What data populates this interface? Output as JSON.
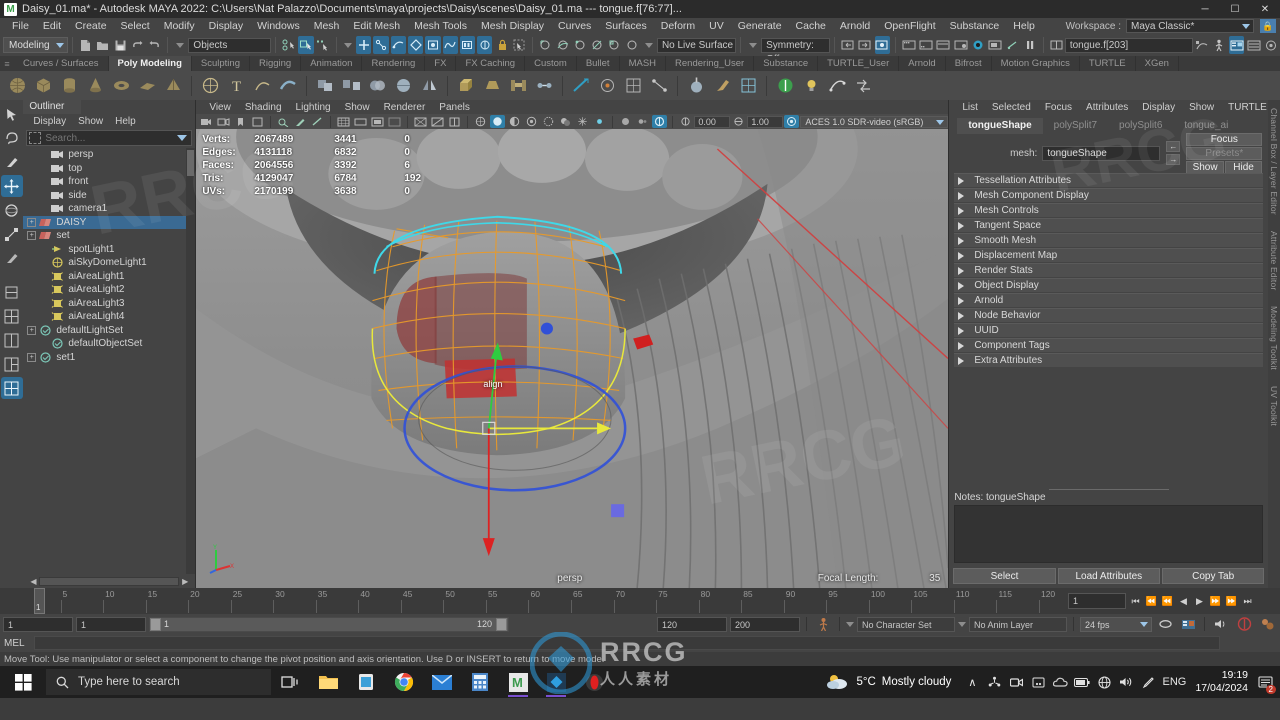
{
  "titlebar": {
    "logo": "M",
    "title": "Daisy_01.ma* - Autodesk MAYA 2022: C:\\Users\\Nat Palazzo\\Documents\\maya\\projects\\Daisy\\scenes\\Daisy_01.ma   ---   tongue.f[76:77]...",
    "minimize": "─",
    "maximize": "☐",
    "close": "✕"
  },
  "menubar": {
    "items": [
      "File",
      "Edit",
      "Create",
      "Select",
      "Modify",
      "Display",
      "Windows",
      "Mesh",
      "Edit Mesh",
      "Mesh Tools",
      "Mesh Display",
      "Curves",
      "Surfaces",
      "Deform",
      "UV",
      "Generate",
      "Cache",
      "Arnold",
      "OpenFlight",
      "Substance",
      "Help"
    ],
    "workspace_label": "Workspace :",
    "workspace_value": "Maya Classic*",
    "lock_icon": "lock-icon"
  },
  "statusbar": {
    "mode": "Modeling",
    "objects_field": "Objects",
    "live_surface": "No Live Surface",
    "symmetry": "Symmetry: Off",
    "selection_field": "tongue.f[203]"
  },
  "shelf_tabs": {
    "items": [
      "Curves / Surfaces",
      "Poly Modeling",
      "Sculpting",
      "Rigging",
      "Animation",
      "Rendering",
      "FX",
      "FX Caching",
      "Custom",
      "Bullet",
      "MASH",
      "Rendering_User",
      "Substance",
      "TURTLE_User",
      "Arnold",
      "Bifrost",
      "Motion Graphics",
      "TURTLE",
      "XGen"
    ],
    "selected": "Poly Modeling"
  },
  "outliner": {
    "tab": "Outliner",
    "menus": [
      "Display",
      "Show",
      "Help"
    ],
    "search_placeholder": "Search...",
    "items": [
      {
        "label": "persp",
        "icon": "camera-icon",
        "expandable": false,
        "selected": false,
        "indent": 1
      },
      {
        "label": "top",
        "icon": "camera-icon",
        "expandable": false,
        "selected": false,
        "indent": 1
      },
      {
        "label": "front",
        "icon": "camera-icon",
        "expandable": false,
        "selected": false,
        "indent": 1
      },
      {
        "label": "side",
        "icon": "camera-icon",
        "expandable": false,
        "selected": false,
        "indent": 1
      },
      {
        "label": "camera1",
        "icon": "camera-icon",
        "expandable": false,
        "selected": false,
        "indent": 1
      },
      {
        "label": "DAISY",
        "icon": "group-icon",
        "expandable": true,
        "selected": true,
        "indent": 0
      },
      {
        "label": "set",
        "icon": "group-icon",
        "expandable": true,
        "selected": false,
        "indent": 0
      },
      {
        "label": "spotLight1",
        "icon": "spotlight-icon",
        "expandable": false,
        "selected": false,
        "indent": 1
      },
      {
        "label": "aiSkyDomeLight1",
        "icon": "skydome-icon",
        "expandable": false,
        "selected": false,
        "indent": 1
      },
      {
        "label": "aiAreaLight1",
        "icon": "arealight-icon",
        "expandable": false,
        "selected": false,
        "indent": 1
      },
      {
        "label": "aiAreaLight2",
        "icon": "arealight-icon",
        "expandable": false,
        "selected": false,
        "indent": 1
      },
      {
        "label": "aiAreaLight3",
        "icon": "arealight-icon",
        "expandable": false,
        "selected": false,
        "indent": 1
      },
      {
        "label": "aiAreaLight4",
        "icon": "arealight-icon",
        "expandable": false,
        "selected": false,
        "indent": 1
      },
      {
        "label": "defaultLightSet",
        "icon": "set-icon",
        "expandable": true,
        "selected": false,
        "indent": 0
      },
      {
        "label": "defaultObjectSet",
        "icon": "set-icon",
        "expandable": false,
        "selected": false,
        "indent": 1
      },
      {
        "label": "set1",
        "icon": "set-icon",
        "expandable": true,
        "selected": false,
        "indent": 0
      }
    ]
  },
  "viewport": {
    "menus": [
      "View",
      "Shading",
      "Lighting",
      "Show",
      "Renderer",
      "Panels"
    ],
    "exposure": "0.00",
    "gamma": "1.00",
    "color_management": "ACES 1.0 SDR-video (sRGB)",
    "camera_label": "persp",
    "focal_length_label": "Focal Length:",
    "focal_length_value": "35",
    "hud": {
      "rows": [
        {
          "label": "Verts:",
          "total": "2067489",
          "selected": "3441",
          "component": "0"
        },
        {
          "label": "Edges:",
          "total": "4131118",
          "selected": "6832",
          "component": "0"
        },
        {
          "label": "Faces:",
          "total": "2064556",
          "selected": "3392",
          "component": "6"
        },
        {
          "label": "Tris:",
          "total": "4129047",
          "selected": "6784",
          "component": "192"
        },
        {
          "label": "UVs:",
          "total": "2170199",
          "selected": "3638",
          "component": "0"
        }
      ]
    },
    "manipulator_label": "align"
  },
  "attribute_editor": {
    "menus": [
      "List",
      "Selected",
      "Focus",
      "Attributes",
      "Display",
      "Show",
      "TURTLE",
      "Help"
    ],
    "tabs": [
      "tongueShape",
      "polySplit7",
      "polySplit6",
      "tongue_ai"
    ],
    "selected_tab": "tongueShape",
    "mesh_label": "mesh:",
    "mesh_value": "tongueShape",
    "focus_button": "Focus",
    "presets_button": "Presets*",
    "show_button": "Show",
    "hide_button": "Hide",
    "sections": [
      "Tessellation Attributes",
      "Mesh Component Display",
      "Mesh Controls",
      "Tangent Space",
      "Smooth Mesh",
      "Displacement Map",
      "Render Stats",
      "Object Display",
      "Arnold",
      "Node Behavior",
      "UUID",
      "Component Tags",
      "Extra Attributes"
    ],
    "notes_label": "Notes:  tongueShape",
    "buttons": [
      "Select",
      "Load Attributes",
      "Copy Tab"
    ],
    "side_tabs": [
      "Channel Box / Layer Editor",
      "Attribute Editor",
      "Modeling Toolkit",
      "UV Toolkit"
    ]
  },
  "timeline": {
    "ticks": [
      5,
      10,
      15,
      20,
      25,
      30,
      35,
      40,
      45,
      50,
      55,
      60,
      65,
      70,
      75,
      80,
      85,
      90,
      95,
      100,
      105,
      110,
      115,
      120
    ],
    "current_frame": "1",
    "current_frame_field": "1",
    "playback_buttons": [
      "go-to-start-icon",
      "step-back-key-icon",
      "step-back-frame-icon",
      "play-backwards-icon",
      "play-forwards-icon",
      "step-forward-frame-icon",
      "step-forward-key-icon",
      "go-to-end-icon"
    ]
  },
  "rangebar": {
    "start_field": "1",
    "end_field": "1",
    "range_start": "1",
    "range_end": "120",
    "anim_start": "120",
    "anim_end": "200",
    "character_set": "No Character Set",
    "anim_layer": "No Anim Layer",
    "fps": "24 fps"
  },
  "mel": {
    "label": "MEL",
    "value": ""
  },
  "help": {
    "text": "Move Tool: Use manipulator or select a component to change the pivot position and axis orientation. Use D or INSERT to return to move mode."
  },
  "taskbar": {
    "search_placeholder": "Type here to search",
    "apps": [
      "task-view-icon",
      "file-explorer-icon",
      "microsoft-store-icon",
      "chrome-icon",
      "mail-icon",
      "calculator-icon",
      "maya-icon",
      "blender-icon",
      "opera-icon"
    ],
    "weather_temp": "5°C",
    "weather_text": "Mostly cloudy",
    "tray_icons": [
      "chevron-up-icon",
      "network-share-icon",
      "camera-icon",
      "dots-icon",
      "onedrive-icon",
      "battery-icon",
      "network-globe-icon",
      "volume-icon",
      "pen-icon"
    ],
    "language": "ENG",
    "time": "19:19",
    "date": "17/04/2024",
    "notification_count": "2"
  },
  "colors": {
    "accent_blue": "#2f6d96",
    "selection_blue": "#3a6a93",
    "panel_bg": "#444444",
    "viewport_bg": "#8a8a8a",
    "orange": "#e07a3a"
  }
}
